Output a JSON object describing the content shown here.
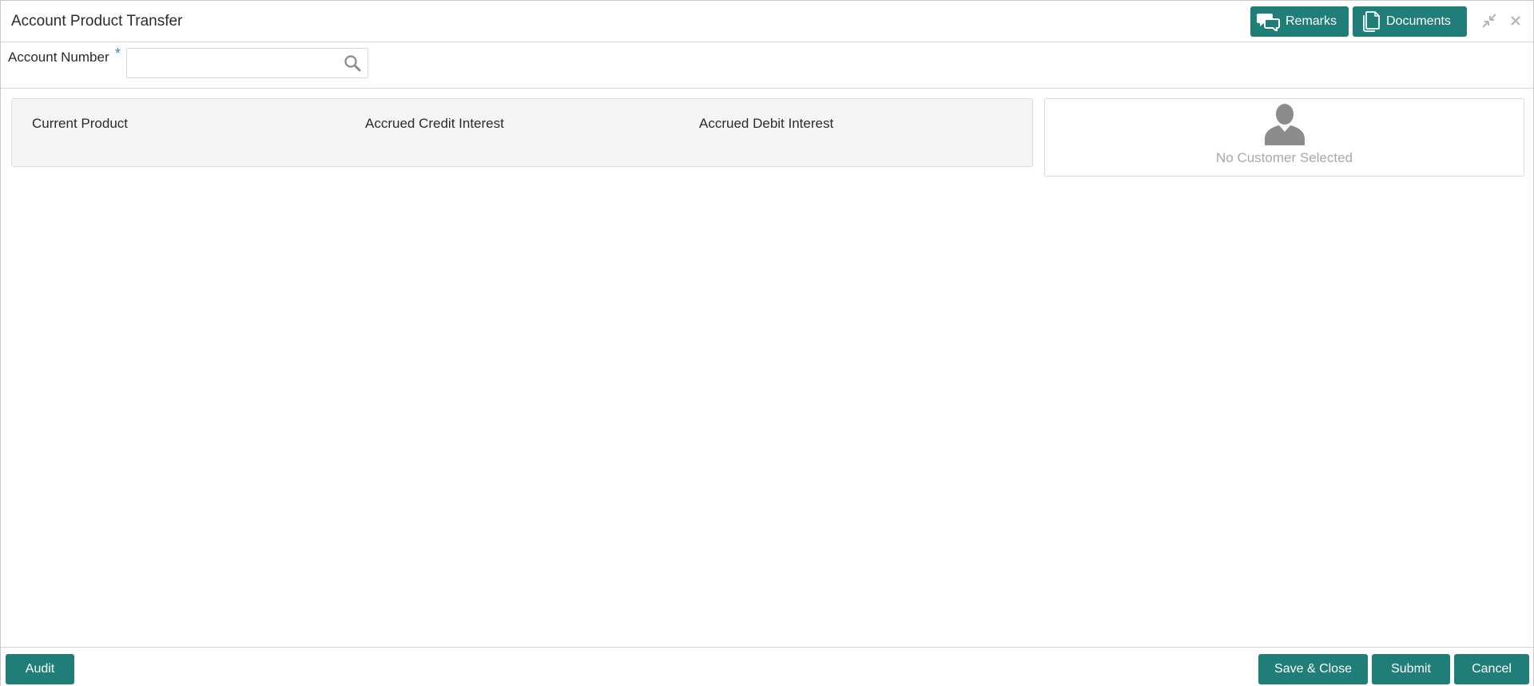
{
  "header": {
    "title": "Account Product Transfer",
    "remarks_label": "Remarks",
    "documents_label": "Documents",
    "icons": {
      "remarks": "chat-bubbles-icon",
      "documents": "documents-icon",
      "minimize": "minimize-icon",
      "close": "close-icon"
    }
  },
  "account": {
    "label": "Account Number",
    "required_mark": "*",
    "value": "",
    "placeholder": "",
    "search_icon": "search-icon"
  },
  "product_panel": {
    "fields": [
      {
        "label": "Current Product"
      },
      {
        "label": "Accrued Credit Interest"
      },
      {
        "label": "Accrued Debit Interest"
      }
    ]
  },
  "customer_panel": {
    "avatar_icon": "user-avatar-icon",
    "empty_text": "No Customer Selected"
  },
  "footer": {
    "audit_label": "Audit",
    "save_close_label": "Save & Close",
    "submit_label": "Submit",
    "cancel_label": "Cancel"
  },
  "colors": {
    "accent": "#1f7f78",
    "required": "#3a8ac6",
    "panel_bg": "#f5f5f5",
    "muted_text": "#a9a9a9"
  }
}
